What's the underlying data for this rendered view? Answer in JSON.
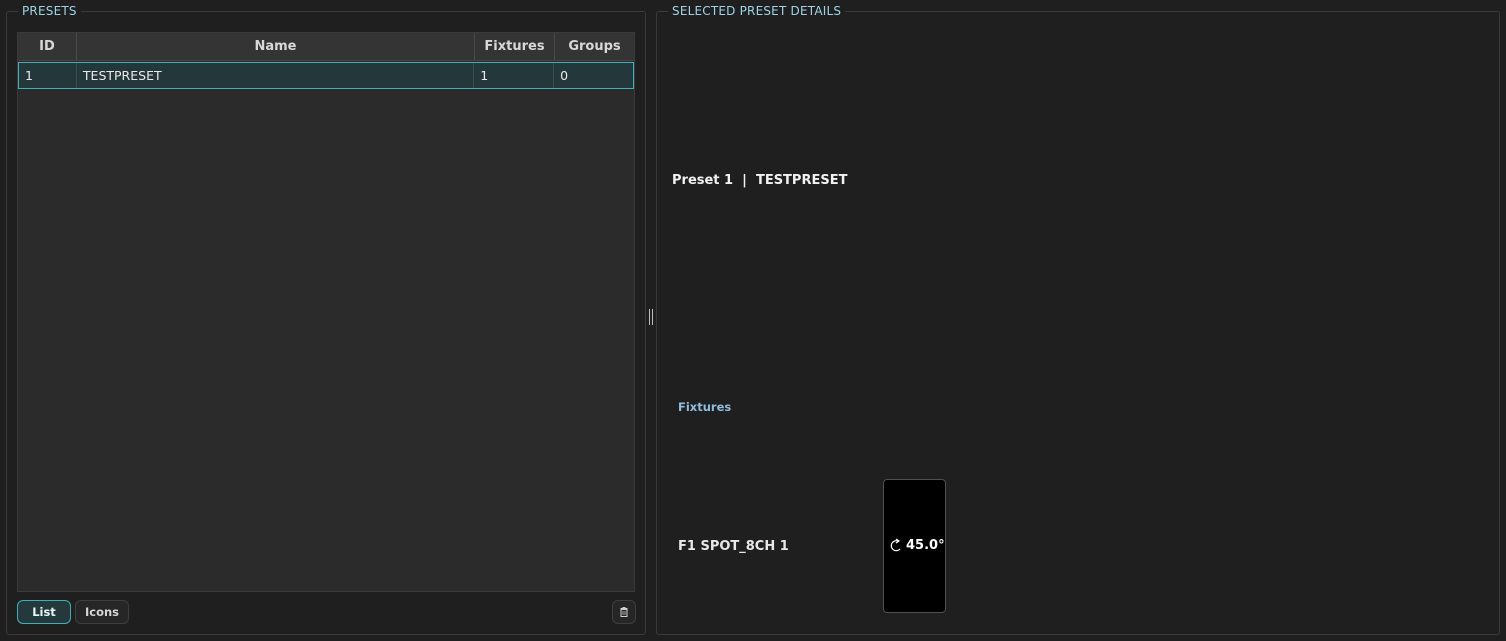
{
  "presets_panel": {
    "title": "PRESETS",
    "columns": [
      "ID",
      "Name",
      "Fixtures",
      "Groups"
    ],
    "rows": [
      {
        "id": "1",
        "name": "TESTPRESET",
        "fixtures": "1",
        "groups": "0",
        "selected": true
      }
    ],
    "view_buttons": {
      "list": "List",
      "icons": "Icons",
      "active": "list"
    },
    "delete_icon": "trash-icon"
  },
  "details_panel": {
    "title": "SELECTED PRESET DETAILS",
    "heading": "Preset 1  |  TESTPRESET",
    "fixtures_label": "Fixtures",
    "fixtures": [
      {
        "name": "F1 SPOT_8CH 1",
        "icon": "rotate-icon",
        "value": "45.0°"
      }
    ]
  },
  "colors": {
    "accent": "#3fb0b5",
    "section_title": "#9ed3e6",
    "subheading": "#8fbde0",
    "background": "#1f1f1f"
  }
}
